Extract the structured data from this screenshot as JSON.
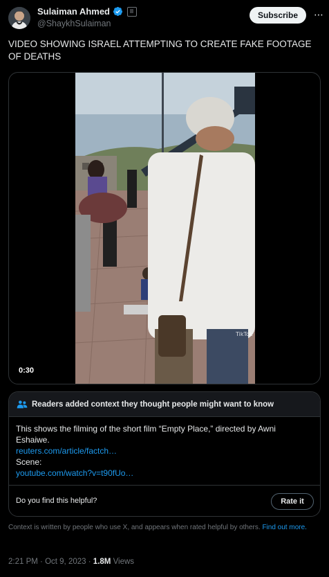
{
  "author": {
    "name": "Sulaiman Ahmed",
    "handle": "@ShaykhSulaiman",
    "avatar_icon": "user-avatar",
    "verified_icon": "verified-badge-icon",
    "colors": {
      "verified": "#1d9bf0"
    }
  },
  "header": {
    "subscribe_label": "Subscribe",
    "more_label": "⋯"
  },
  "tweet": {
    "text": "VIDEO SHOWING ISRAEL ATTEMPTING TO CREATE FAKE FOOTAGE OF DEATHS"
  },
  "media": {
    "duration": "0:30",
    "watermark": "TikTok"
  },
  "note": {
    "header": "Readers added context they thought people might want to know",
    "body_text": "This shows the filming of the short film “Empty Place,” directed by Awni Eshaiwe.",
    "link1": "reuters.com/article/factch…",
    "scene_label": "Scene:",
    "link2": "youtube.com/watch?v=t90fUo…",
    "helpful_question": "Do you find this helpful?",
    "rate_label": "Rate it"
  },
  "context": {
    "text": "Context is written by people who use X, and appears when rated helpful by others.",
    "find_out_more": "Find out more."
  },
  "meta": {
    "time": "2:21 PM",
    "separator": "·",
    "date": "Oct 9, 2023",
    "views_count": "1.8M",
    "views_label": "Views"
  },
  "colors": {
    "background": "#000000",
    "text": "#e7e9ea",
    "secondary": "#71767b",
    "link": "#1d9bf0",
    "border": "#2f3336"
  }
}
